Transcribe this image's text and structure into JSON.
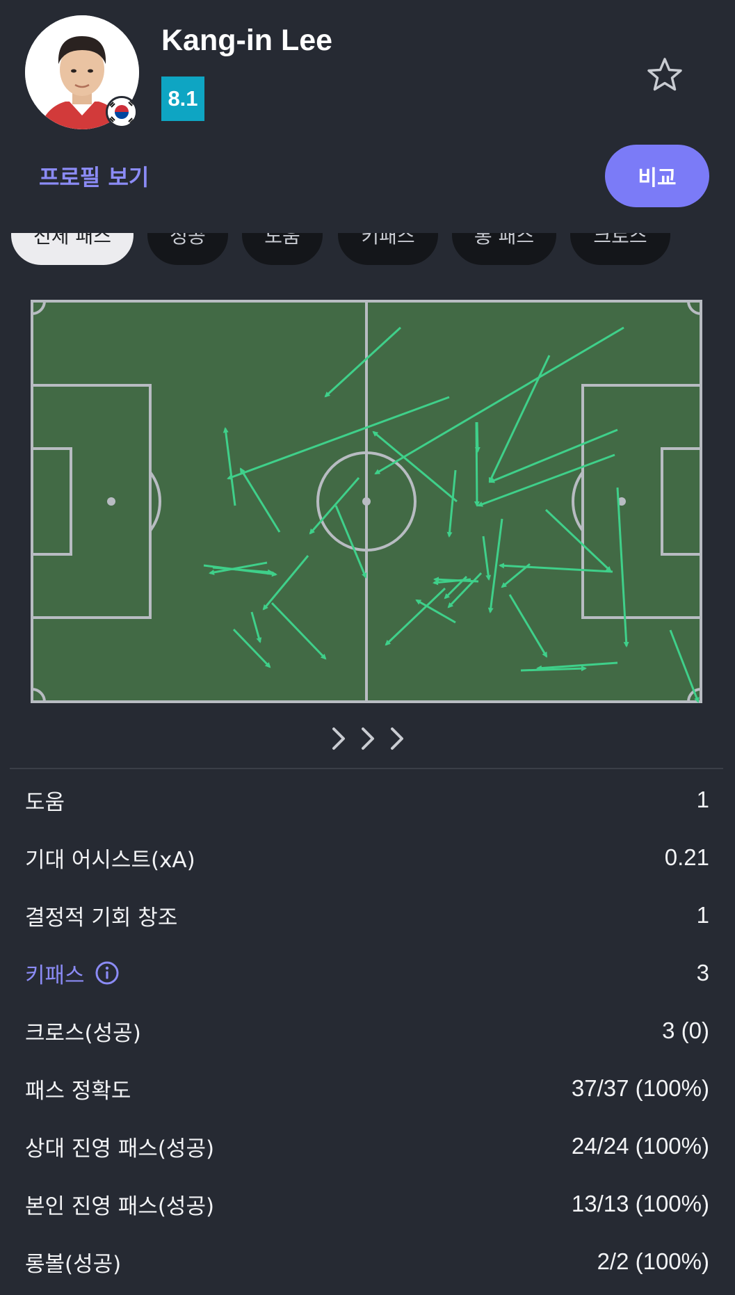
{
  "player": {
    "name": "Kang-in Lee",
    "rating": "8.1",
    "rating_color": "#0ea5c3",
    "avatar_icon": "player-photo",
    "flag_icon": "south-korea-flag"
  },
  "header": {
    "profile_link": "프로필 보기",
    "compare_button": "비교",
    "star_icon": "star-outline-icon",
    "accent_color": "#7b7bf7"
  },
  "tabs": [
    {
      "label": "전체 패스",
      "active": true
    },
    {
      "label": "성공",
      "active": false
    },
    {
      "label": "도움",
      "active": false
    },
    {
      "label": "키패스",
      "active": false
    },
    {
      "label": "롱 패스",
      "active": false
    },
    {
      "label": "크로스",
      "active": false
    }
  ],
  "pass_map": {
    "pitch_color": "#426a45",
    "line_color": "#b8bcc2",
    "arrow_color": "#3fd08a",
    "pagination_icon": "triple-chevron-right-icon"
  },
  "stats": [
    {
      "label": "도움",
      "value": "1"
    },
    {
      "label": "기대 어시스트(xA)",
      "value": "0.21"
    },
    {
      "label": "결정적 기회 창조",
      "value": "1"
    },
    {
      "label": "키패스",
      "value": "3",
      "link": true,
      "icon": "info-icon"
    },
    {
      "label": "크로스(성공)",
      "value": "3 (0)"
    },
    {
      "label": "패스 정확도",
      "value": "37/37 (100%)"
    },
    {
      "label": "상대 진영 패스(성공)",
      "value": "24/24 (100%)"
    },
    {
      "label": "본인 진영 패스(성공)",
      "value": "13/13 (100%)"
    },
    {
      "label": "롱볼(성공)",
      "value": "2/2 (100%)"
    }
  ]
}
